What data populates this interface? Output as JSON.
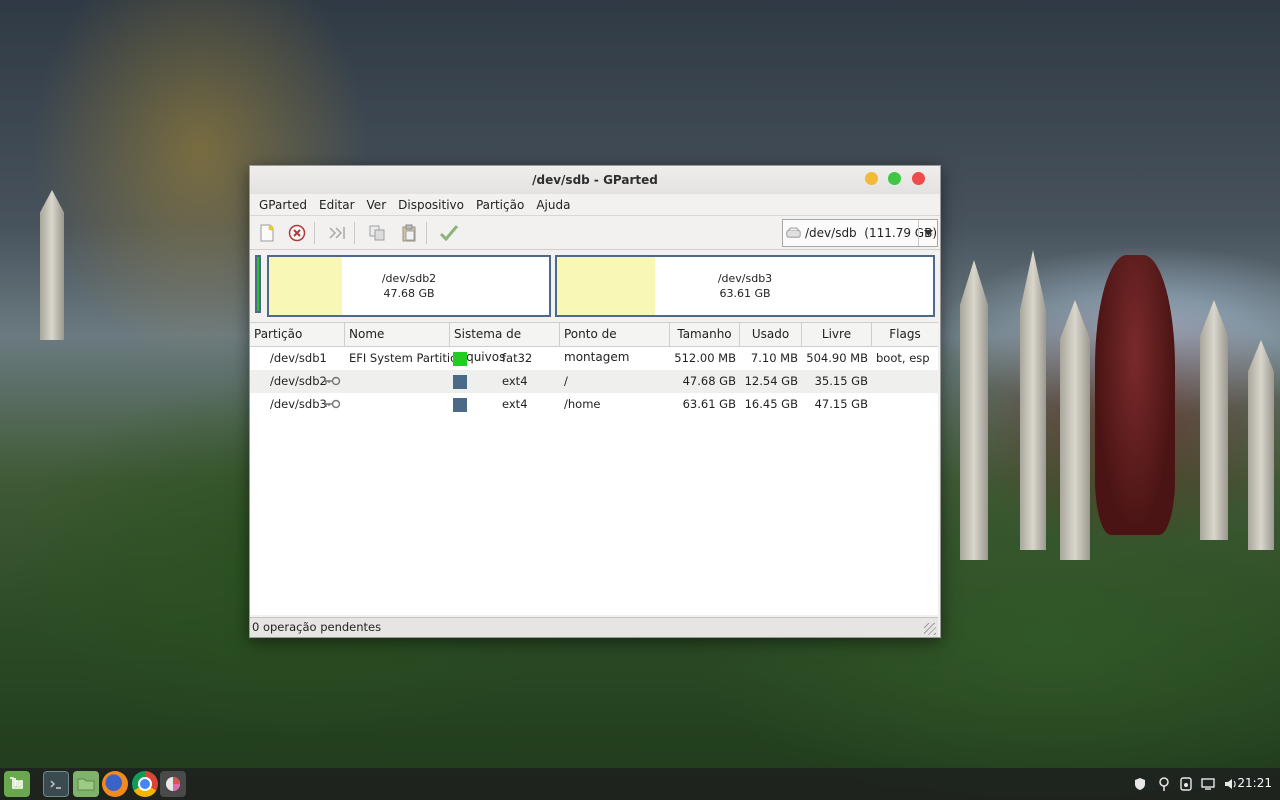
{
  "window": {
    "title": "/dev/sdb - GParted"
  },
  "menu": [
    "GParted",
    "Editar",
    "Ver",
    "Dispositivo",
    "Partição",
    "Ajuda"
  ],
  "toolbar": {
    "device": "/dev/sdb  (111.79 GB)"
  },
  "diskmap": [
    {
      "name": "/dev/sdb2",
      "size": "47.68 GB",
      "used_fraction": 0.26
    },
    {
      "name": "/dev/sdb3",
      "size": "63.61 GB",
      "used_fraction": 0.26
    }
  ],
  "table": {
    "headers": [
      "Partição",
      "Nome",
      "Sistema de arquivos",
      "Ponto de montagem",
      "Tamanho",
      "Usado",
      "Livre",
      "Flags"
    ],
    "rows": [
      {
        "partition": "/dev/sdb1",
        "name": "EFI System Partition",
        "fs": "fat32",
        "fs_color": "#22cc22",
        "mount": "",
        "size": "512.00 MB",
        "used": "7.10 MB",
        "free": "504.90 MB",
        "flags": "boot, esp",
        "locked": false
      },
      {
        "partition": "/dev/sdb2",
        "name": "",
        "fs": "ext4",
        "fs_color": "#4b6a88",
        "mount": "/",
        "size": "47.68 GB",
        "used": "12.54 GB",
        "free": "35.15 GB",
        "flags": "",
        "locked": true
      },
      {
        "partition": "/dev/sdb3",
        "name": "",
        "fs": "ext4",
        "fs_color": "#4b6a88",
        "mount": "/home",
        "size": "63.61 GB",
        "used": "16.45 GB",
        "free": "47.15 GB",
        "flags": "",
        "locked": true
      }
    ]
  },
  "status": "0 operação pendentes",
  "taskbar": {
    "clock": "21:21",
    "apps": [
      "menu-icon",
      "terminal-icon",
      "files-icon",
      "firefox-icon",
      "chrome-icon",
      "gparted-icon"
    ]
  }
}
